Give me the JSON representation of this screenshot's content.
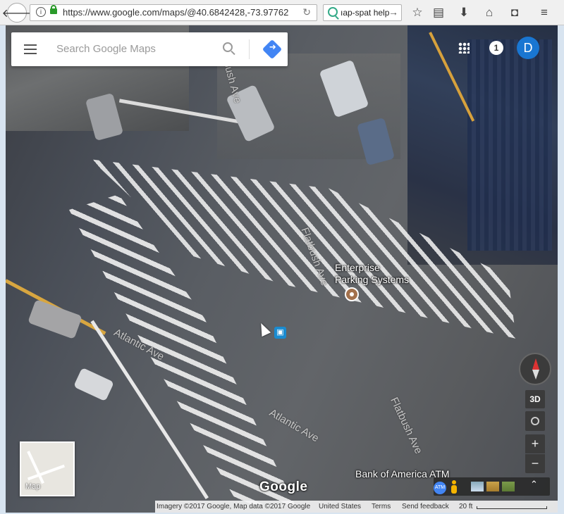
{
  "browser": {
    "url": "https://www.google.com/maps/@40.6842428,-73.97762",
    "search_text": "ıap-spat help"
  },
  "maps": {
    "search_placeholder": "Search Google Maps",
    "notification_count": "1",
    "avatar_letter": "D",
    "poi": {
      "name_line1": "Enterprise",
      "name_line2": "Parking Systems"
    },
    "atm_label": "Bank of America ATM",
    "atm_badge": "ATM",
    "streets": {
      "flatbush_top": "Flatbush Ave",
      "flatbush_mid": "Flatbush Ave",
      "atlantic_left": "Atlantic Ave",
      "atlantic_mid": "Atlantic Ave",
      "flatbush_bottom": "Flatbush Ave"
    },
    "button_3d": "3D",
    "zoom_in": "+",
    "zoom_out": "−",
    "map_type_label": "Map",
    "logo": "Google"
  },
  "footer": {
    "imagery": "Imagery ©2017 Google, Map data ©2017 Google",
    "country": "United States",
    "terms": "Terms",
    "feedback": "Send feedback",
    "scale": "20 ft"
  }
}
